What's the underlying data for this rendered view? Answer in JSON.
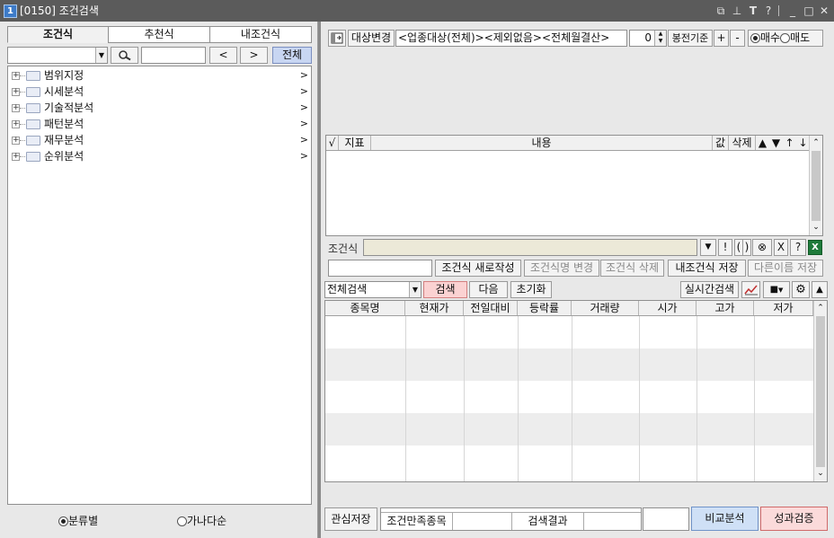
{
  "window": {
    "number": "1",
    "title": "[0150] 조건검색"
  },
  "titlebar_icons": [
    "window-icon",
    "pin-icon",
    "text-icon",
    "help-icon",
    "minimize-icon",
    "maximize-icon",
    "close-icon"
  ],
  "titlebar_glyphs": [
    "⧉",
    "⊥",
    "T",
    "?",
    "_",
    "□",
    "✕"
  ],
  "left": {
    "tabs": [
      "조건식",
      "추천식",
      "내조건식"
    ],
    "search": {
      "nav_prev": "<",
      "nav_next": ">",
      "all_button": "전체"
    },
    "tree": [
      {
        "label": "범위지정"
      },
      {
        "label": "시세분석"
      },
      {
        "label": "기술적분석"
      },
      {
        "label": "패턴분석"
      },
      {
        "label": "재무분석"
      },
      {
        "label": "순위분석"
      }
    ],
    "sort": {
      "by_category": "분류별",
      "by_alpha": "가나다순"
    }
  },
  "right": {
    "target_button": "대상변경",
    "target_text": "<업종대상(전체)><제외없음><전체월결산>",
    "spinner_value": "0",
    "candle_basis": "봉전기준",
    "plus": "+",
    "minus": "-",
    "buy": "매수",
    "sell": "매도",
    "table_headers": {
      "check": "√",
      "indicator": "지표",
      "content": "내용",
      "value": "값",
      "delete": "삭제",
      "up_all": "▲",
      "down_all": "▼",
      "up": "↑",
      "down": "↓"
    },
    "condition_label": "조건식",
    "cond_ops": [
      "▼",
      "!",
      "(",
      ")",
      "⊗",
      "X",
      "?"
    ],
    "actions": [
      "조건식 새로작성",
      "조건식명 변경",
      "조건식 삭제",
      "내조건식 저장",
      "다른이름 저장"
    ],
    "search_mode": "전체검색",
    "search_button": "검색",
    "next_button": "다음",
    "reset_button": "초기화",
    "realtime_button": "실시간검색",
    "columns": [
      "종목명",
      "현재가",
      "전일대비",
      "등락률",
      "거래량",
      "시가",
      "고가",
      "저가"
    ],
    "status": {
      "save_interest": "관심저장",
      "matched_label": "조건만족종목",
      "matched_value": "",
      "result_label": "검색결과",
      "result_value": "",
      "extra": "",
      "compare": "비교분석",
      "performance": "성과검증"
    }
  }
}
